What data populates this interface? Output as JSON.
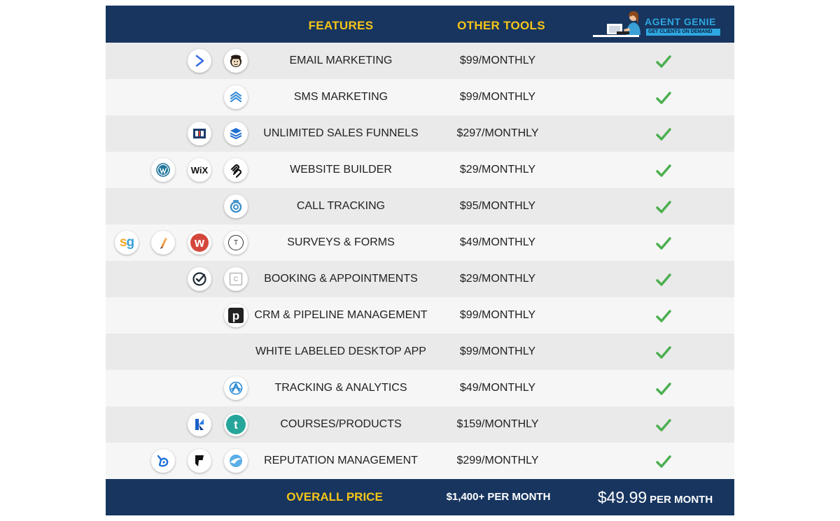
{
  "header": {
    "features_label": "FEATURES",
    "other_tools_label": "OTHER TOOLS",
    "brand_name": "AGENT GENIE",
    "brand_tagline": "GET CLIENTS ON DEMAND"
  },
  "colors": {
    "header_bg": "#17355f",
    "header_text": "#f5c518",
    "row_odd": "#eaeaea",
    "row_even": "#f6f6f6",
    "check": "#4caf50",
    "brand": "#2ea6e0"
  },
  "rows": [
    {
      "feature": "EMAIL MARKETING",
      "price": "$99/MONTHLY",
      "icons": [
        "mailchimp-icon",
        "activecampaign-icon"
      ],
      "included": true
    },
    {
      "feature": "SMS MARKETING",
      "price": "$99/MONTHLY",
      "icons": [
        "sms-chevrons-icon"
      ],
      "included": true
    },
    {
      "feature": "UNLIMITED SALES FUNNELS",
      "price": "$297/MONTHLY",
      "icons": [
        "stacked-layers-icon",
        "clickfunnels-icon"
      ],
      "included": true
    },
    {
      "feature": "WEBSITE BUILDER",
      "price": "$29/MONTHLY",
      "icons": [
        "squarespace-icon",
        "wix-icon",
        "wordpress-icon"
      ],
      "included": true
    },
    {
      "feature": "CALL TRACKING",
      "price": "$95/MONTHLY",
      "icons": [
        "callrail-icon"
      ],
      "included": true
    },
    {
      "feature": "SURVEYS & FORMS",
      "price": "$49/MONTHLY",
      "icons": [
        "typeform-icon",
        "wufoo-icon",
        "pencil-icon",
        "surveygizmo-icon"
      ],
      "included": true
    },
    {
      "feature": "BOOKING & APPOINTMENTS",
      "price": "$29/MONTHLY",
      "icons": [
        "calendar-icon",
        "acuity-check-icon"
      ],
      "included": true
    },
    {
      "feature": "CRM & PIPELINE MANAGEMENT",
      "price": "$99/MONTHLY",
      "icons": [
        "pipedrive-icon"
      ],
      "included": true
    },
    {
      "feature": "WHITE LABELED DESKTOP APP",
      "price": "$99/MONTHLY",
      "icons": [],
      "included": true
    },
    {
      "feature": "TRACKING & ANALYTICS",
      "price": "$49/MONTHLY",
      "icons": [
        "analytics-icon"
      ],
      "included": true
    },
    {
      "feature": "COURSES/PRODUCTS",
      "price": "$159/MONTHLY",
      "icons": [
        "teachable-icon",
        "kajabi-icon"
      ],
      "included": true
    },
    {
      "feature": "REPUTATION MANAGEMENT",
      "price": "$299/MONTHLY",
      "icons": [
        "birdeye-icon",
        "foursquare-icon",
        "bird-wing-icon"
      ],
      "included": true
    }
  ],
  "icon_text": {
    "wix": "WiX",
    "typeform": "T",
    "wufoo": "w",
    "surveygizmo_s": "s",
    "surveygizmo_g": "g",
    "pipedrive": "p",
    "teachable": "t",
    "calendar": "C"
  },
  "footer": {
    "label": "OVERALL PRICE",
    "other_total": "$1,400+ PER MONTH",
    "our_amount": "$49.99",
    "our_per": "PER MONTH"
  }
}
